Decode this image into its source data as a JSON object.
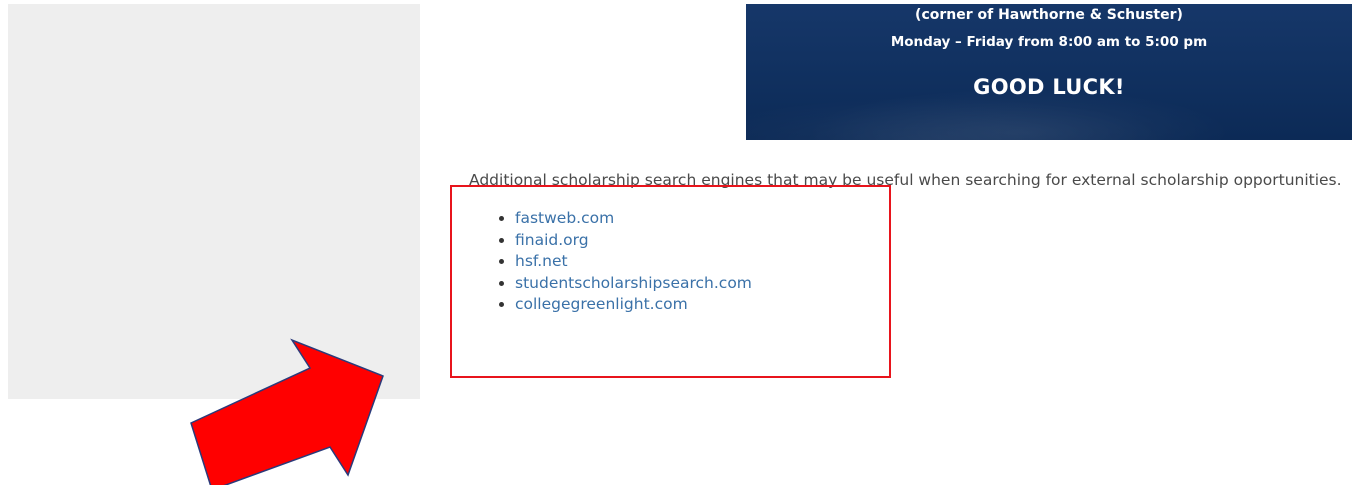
{
  "banner": {
    "line1": "(corner of Hawthorne & Schuster)",
    "line2": "Monday – Friday from 8:00 am to 5:00 pm",
    "line3": "GOOD LUCK!"
  },
  "content": {
    "intro": "Additional scholarship search engines that may be useful when searching for external scholarship opportunities.",
    "links": [
      {
        "label": "fastweb.com"
      },
      {
        "label": "finaid.org"
      },
      {
        "label": "hsf.net"
      },
      {
        "label": "studentscholarshipsearch.com"
      },
      {
        "label": "collegegreenlight.com"
      }
    ]
  },
  "annotations": {
    "highlight_color": "#e8141c",
    "arrow_color": "#ff0000",
    "arrow_outline_color": "#2b3a7a"
  }
}
